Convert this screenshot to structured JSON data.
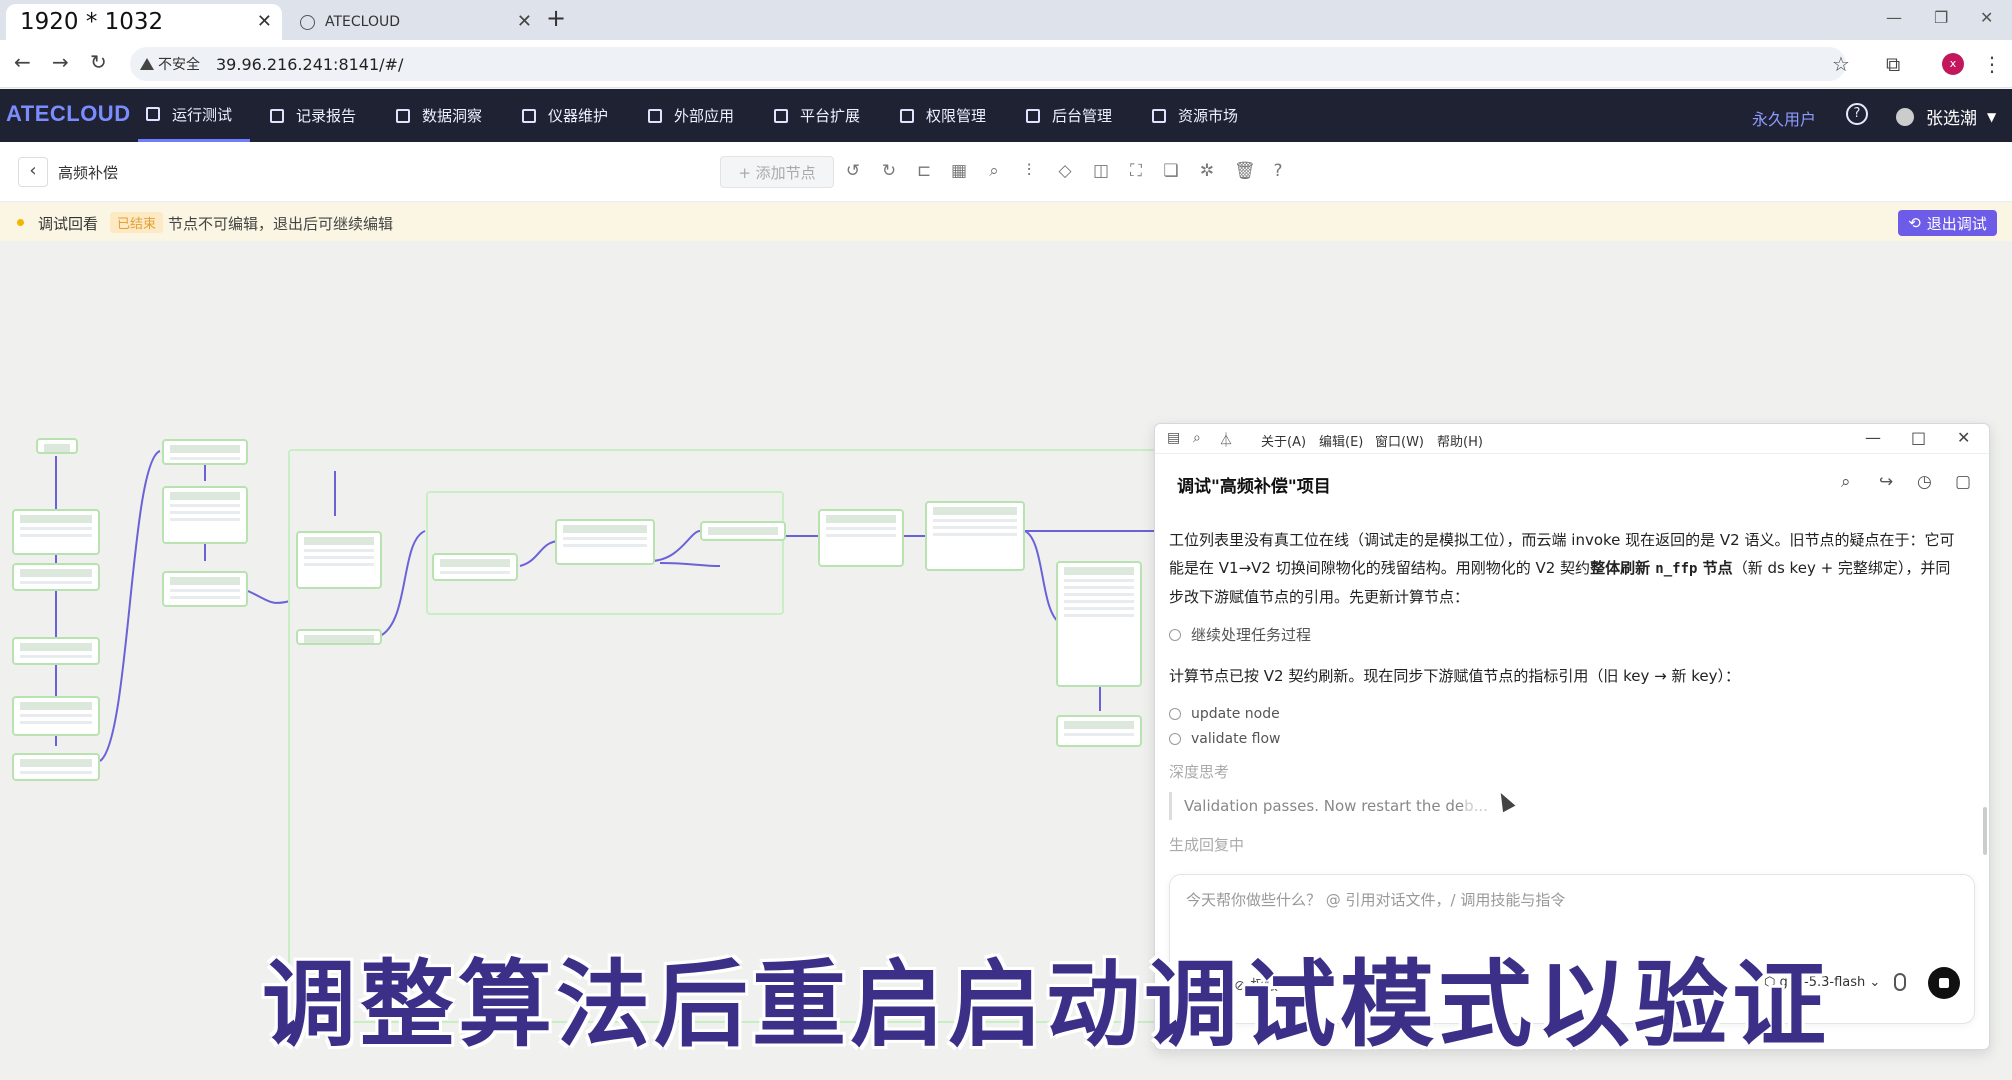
{
  "browser": {
    "active_tab_title": "1920 * 1032",
    "second_tab_title": "ATECLOUD",
    "security_label": "不安全",
    "url": "39.96.216.241:8141/#/"
  },
  "app": {
    "logo": "ATECLOUD",
    "nav_items": [
      {
        "label": "运行测试",
        "icon": "chart-icon",
        "active": true
      },
      {
        "label": "记录报告",
        "icon": "report-icon"
      },
      {
        "label": "数据洞察",
        "icon": "monitor-icon"
      },
      {
        "label": "仪器维护",
        "icon": "instrument-icon"
      },
      {
        "label": "外部应用",
        "icon": "grid-icon"
      },
      {
        "label": "平台扩展",
        "icon": "extension-icon"
      },
      {
        "label": "权限管理",
        "icon": "shield-icon"
      },
      {
        "label": "后台管理",
        "icon": "admin-icon"
      },
      {
        "label": "资源市场",
        "icon": "tag-icon"
      }
    ],
    "user_tier": "永久用户",
    "user_name": "张选潮"
  },
  "toolbar": {
    "project_name": "高频补偿",
    "add_node_label": "+ 添加节点"
  },
  "banner": {
    "label": "调试回看",
    "status_badge": "已结束",
    "message": "节点不可编辑，退出后可继续编辑",
    "exit_button": "退出调试"
  },
  "chat": {
    "menu": [
      "关于(A)",
      "编辑(E)",
      "窗口(W)",
      "帮助(H)"
    ],
    "title": "调试\"高频补偿\"项目",
    "para1_a": "工位列表里没有真工位在线（调试走的是模拟工位），而云端 invoke 现在返回的是 V2 语义。旧节点的疑点在于：它可能是在 V1→V2 切换间隙物化的残留结构。用刚物化的 V2 契约",
    "para1_bold": "整体刷新 ",
    "para1_code": "n_ffp",
    "para1_bold2": " 节点",
    "para1_b": "（新 ds key + 完整绑定），并同步改下游赋值节点的引用。先更新计算节点：",
    "step_continue": "继续处理任务过程",
    "para2": "计算节点已按 V2 契约刷新。现在同步下游赋值节点的指标引用（旧 key → 新 key）：",
    "step_update": "update node",
    "step_validate": "validate flow",
    "thinking_label": "深度思考",
    "thinking_text": "Validation passes. Now restart the de",
    "thinking_fade": "b...",
    "generating_label": "生成回复中",
    "input_placeholder": "今天帮你做些什么？ @ 引用对话文件，/ 调用技能与指令",
    "permission_label": "权限",
    "model_name": "glm-5.3-flash"
  },
  "caption": "调整算法后重启启动调试模式以验证"
}
